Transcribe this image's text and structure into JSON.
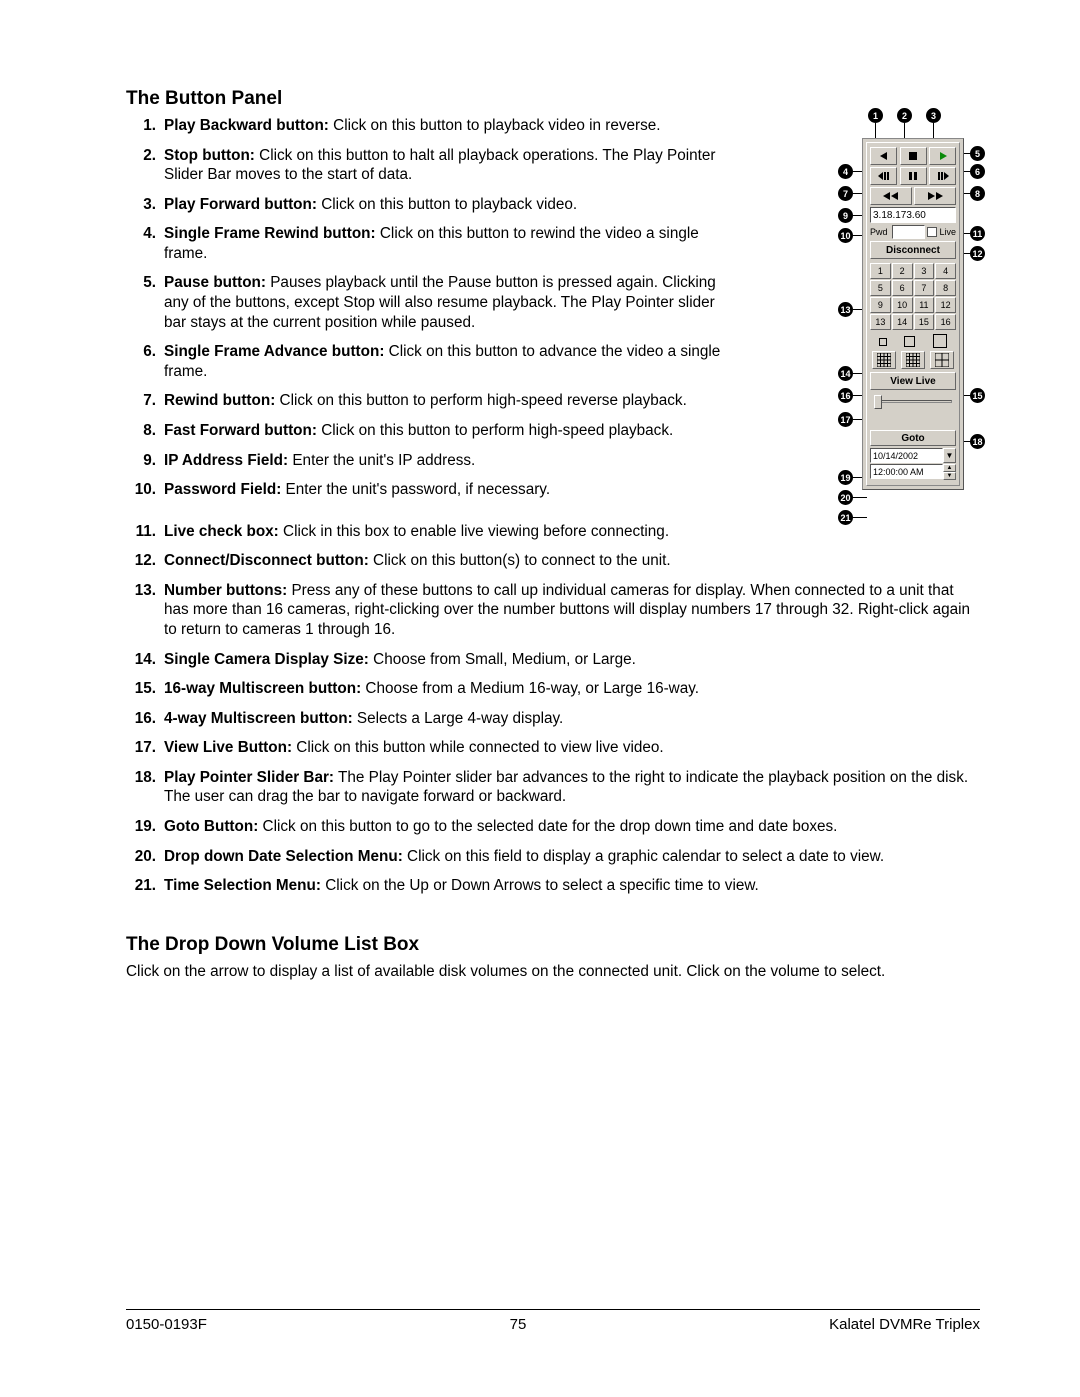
{
  "heading1": "The Button Panel",
  "items": [
    {
      "n": "1.",
      "label": "Play Backward button:",
      "text": " Click on this button to playback video in reverse.",
      "narrow": true
    },
    {
      "n": "2.",
      "label": "Stop button:",
      "text": " Click on this button to halt all playback operations. The Play Pointer Slider Bar moves to the start of data.",
      "narrow": true
    },
    {
      "n": "3.",
      "label": "Play Forward button:",
      "text": " Click on this button to playback video.",
      "narrow": true
    },
    {
      "n": "4.",
      "label": "Single Frame Rewind button:",
      "text": " Click on this button to rewind the video a single frame.",
      "narrow": true
    },
    {
      "n": "5.",
      "label": "Pause button:",
      "text": " Pauses playback until the Pause button is pressed again. Clicking any of the buttons, except Stop will also resume playback. The Play Pointer slider bar stays at the current position while paused.",
      "narrow": true
    },
    {
      "n": "6.",
      "label": "Single Frame Advance button:",
      "text": " Click on this button to advance the video a single frame.",
      "narrow": true
    },
    {
      "n": "7.",
      "label": "Rewind button:",
      "text": " Click on this button to perform high-speed reverse playback.",
      "narrow": true
    },
    {
      "n": "8.",
      "label": "Fast Forward button:",
      "text": " Click on this button to perform high-speed playback.",
      "narrow": true
    },
    {
      "n": "9.",
      "label": "IP Address Field:",
      "text": " Enter the unit's IP address.",
      "narrow": true
    },
    {
      "n": "10.",
      "label": "Password Field:",
      "text": " Enter the unit's password, if necessary.",
      "narrow": true
    },
    {
      "n": "11.",
      "label": "Live check box:",
      "text": " Click in this box to enable live viewing before connecting.",
      "narrow": false
    },
    {
      "n": "12.",
      "label": "Connect/Disconnect button:",
      "text": " Click on this button(s) to connect to the unit.",
      "narrow": false
    },
    {
      "n": "13.",
      "label": "Number buttons:",
      "text": " Press any of these buttons to call up individual cameras for display.  When connected to a unit that has more than 16 cameras, right-clicking over the number buttons will display numbers 17 through 32.  Right-click again to return to cameras 1 through 16.",
      "narrow": false
    },
    {
      "n": "14.",
      "label": "Single Camera Display Size:",
      "text": " Choose from Small, Medium, or Large.",
      "narrow": false
    },
    {
      "n": "15.",
      "label": "16-way Multiscreen button:",
      "text": " Choose from a Medium 16-way, or Large 16-way.",
      "narrow": false
    },
    {
      "n": "16.",
      "label": "4-way Multiscreen button:",
      "text": " Selects a Large 4-way display.",
      "narrow": false
    },
    {
      "n": "17.",
      "label": "View Live Button:",
      "text": " Click on this button while connected to view live video.",
      "narrow": false
    },
    {
      "n": "18.",
      "label": "Play Pointer Slider Bar:",
      "text": " The Play Pointer slider bar advances to the right to indicate the playback position on the disk.  The user can drag the bar to navigate forward or backward.",
      "narrow": false
    },
    {
      "n": "19.",
      "label": "Goto Button:",
      "text": " Click on this button to go to the selected date for the drop down time and date boxes.",
      "narrow": false
    },
    {
      "n": "20.",
      "label": "Drop down Date Selection Menu:",
      "text": " Click on this field to display a graphic calendar to select a date to view.",
      "narrow": false
    },
    {
      "n": "21.",
      "label": "Time Selection Menu:",
      "text": "  Click on the Up or Down Arrows to select a specific time to view.",
      "narrow": false
    }
  ],
  "heading2": "The Drop Down Volume List Box",
  "volume_body": "Click on the arrow to display a list of available disk volumes on the connected unit. Click on the volume to select.",
  "panel": {
    "ip": "3.18.173.60",
    "pwd_label": "Pwd",
    "live_label": "Live",
    "disconnect": "Disconnect",
    "cameras": [
      "1",
      "2",
      "3",
      "4",
      "5",
      "6",
      "7",
      "8",
      "9",
      "10",
      "11",
      "12",
      "13",
      "14",
      "15",
      "16"
    ],
    "view_live": "View Live",
    "goto": "Goto",
    "date": "10/14/2002",
    "time": "12:00:00 AM"
  },
  "footer": {
    "left": "0150-0193F",
    "center": "75",
    "right": "Kalatel DVMRe Triplex"
  }
}
